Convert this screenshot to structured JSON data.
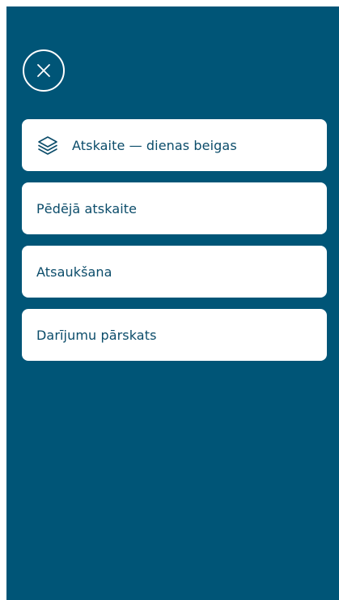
{
  "colors": {
    "background": "#005577",
    "card": "#ffffff",
    "text": "#0b4c6a",
    "close_icon": "#ffffff"
  },
  "header": {
    "close_icon": "close-icon"
  },
  "menu": {
    "items": [
      {
        "label": "Atskaite — dienas beigas",
        "icon": "layers-icon"
      },
      {
        "label": "Pēdējā atskaite"
      },
      {
        "label": "Atsaukšana"
      },
      {
        "label": "Darījumu pārskats"
      }
    ]
  }
}
